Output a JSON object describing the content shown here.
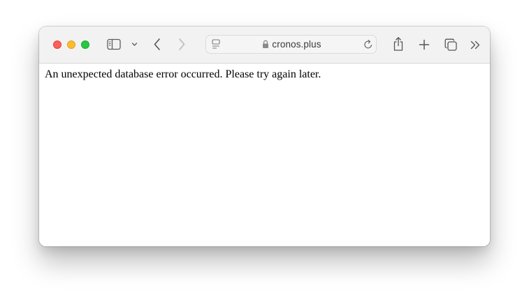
{
  "toolbar": {
    "traffic_lights": {
      "close_color": "#fe5f57",
      "minimize_color": "#febc2e",
      "maximize_color": "#28c840"
    },
    "icons": {
      "sidebar": "sidebar-toggle-icon",
      "sidebar_menu": "chevron-down-icon",
      "back": "chevron-left-icon",
      "forward": "chevron-right-icon",
      "page_menu": "page-menu-icon",
      "secure": "lock-icon",
      "reload": "reload-icon",
      "share": "share-icon",
      "new_tab": "plus-icon",
      "tab_overview": "tab-overview-icon",
      "more": "double-chevron-right-icon"
    },
    "address_bar": {
      "url": "cronos.plus"
    }
  },
  "page": {
    "message": "An unexpected database error occurred. Please try again later."
  }
}
